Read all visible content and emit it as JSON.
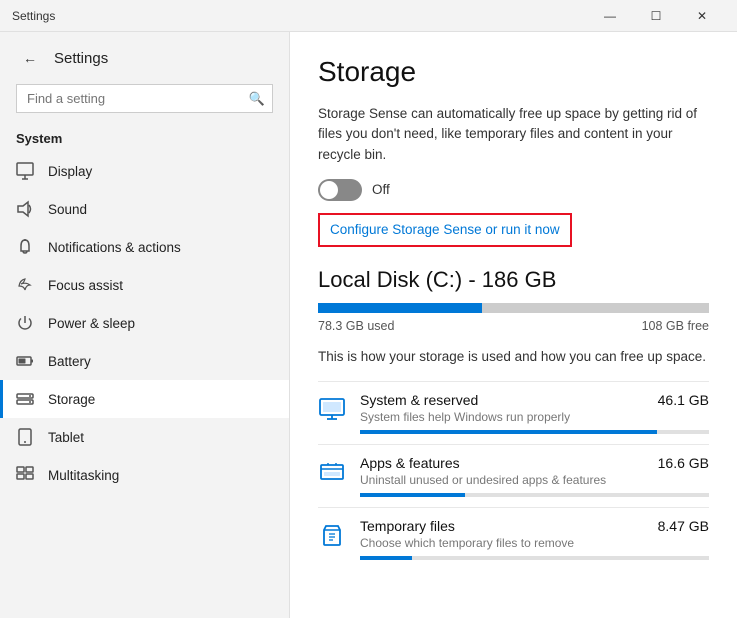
{
  "titlebar": {
    "title": "Settings",
    "minimize": "—",
    "maximize": "☐",
    "close": "✕"
  },
  "sidebar": {
    "back_label": "←",
    "app_title": "Settings",
    "search_placeholder": "Find a setting",
    "search_icon": "🔍",
    "section_label": "System",
    "items": [
      {
        "id": "display",
        "label": "Display",
        "icon": "🖥"
      },
      {
        "id": "sound",
        "label": "Sound",
        "icon": "🔊"
      },
      {
        "id": "notifications",
        "label": "Notifications & actions",
        "icon": "🔔"
      },
      {
        "id": "focus",
        "label": "Focus assist",
        "icon": "🌙"
      },
      {
        "id": "power",
        "label": "Power & sleep",
        "icon": "⏻"
      },
      {
        "id": "battery",
        "label": "Battery",
        "icon": "🔋"
      },
      {
        "id": "storage",
        "label": "Storage",
        "icon": "💾",
        "active": true
      },
      {
        "id": "tablet",
        "label": "Tablet",
        "icon": "📱"
      },
      {
        "id": "multitasking",
        "label": "Multitasking",
        "icon": "⧉"
      }
    ]
  },
  "content": {
    "title": "Storage",
    "storage_sense_desc": "Storage Sense can automatically free up space by getting rid of files you don't need, like temporary files and content in your recycle bin.",
    "toggle_label": "Off",
    "configure_link": "Configure Storage Sense or run it now",
    "local_disk_title": "Local Disk (C:) - 186 GB",
    "disk_used_label": "78.3 GB used",
    "disk_free_label": "108 GB free",
    "disk_used_pct": 42,
    "how_used_text": "This is how your storage is used and how you can free up space.",
    "storage_items": [
      {
        "id": "system",
        "icon": "💻",
        "name": "System & reserved",
        "size": "46.1 GB",
        "desc": "System files help Windows run properly",
        "pct": 85
      },
      {
        "id": "apps",
        "icon": "⊟",
        "name": "Apps & features",
        "size": "16.6 GB",
        "desc": "Uninstall unused or undesired apps & features",
        "pct": 30
      },
      {
        "id": "temp",
        "icon": "🗑",
        "name": "Temporary files",
        "size": "8.47 GB",
        "desc": "Choose which temporary files to remove",
        "pct": 15
      }
    ]
  }
}
